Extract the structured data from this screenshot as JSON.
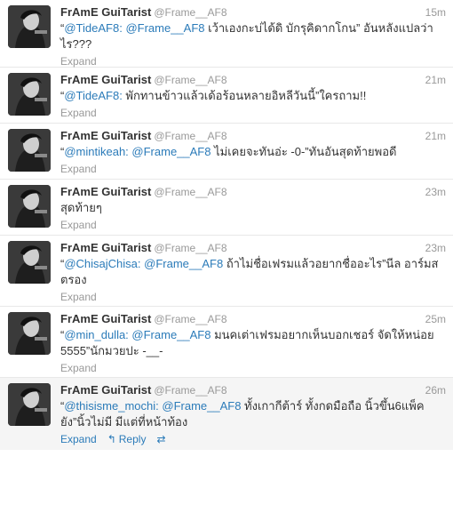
{
  "user": {
    "fullname": "FrAmE GuiTarist",
    "username": "@Frame__AF8"
  },
  "expand_label": "Expand",
  "reply_label": "Reply",
  "tweets": [
    {
      "time": "15m",
      "quote_open": "“",
      "mention1": "@TideAF8:",
      "mention2": "@Frame__AF8",
      "body": " เว้าเองกะบ่ได้ดิ บักรุคิดากโกน” อันหลังแปลว่าไร???"
    },
    {
      "time": "21m",
      "quote_open": "“",
      "mention1": "@TideAF8:",
      "mention2": "",
      "body": " พักทานข้าวแล้วเด้อร้อนหลายอิหลีวันนี้”ใครถาม!!"
    },
    {
      "time": "21m",
      "quote_open": "“",
      "mention1": "@mintikeah:",
      "mention2": "@Frame__AF8",
      "body": " ไม่เคยจะทันอ่ะ -0-”ทันอันสุดท้ายพอดี"
    },
    {
      "time": "23m",
      "quote_open": "",
      "mention1": "",
      "mention2": "",
      "body": "สุดท้ายๆ"
    },
    {
      "time": "23m",
      "quote_open": "“",
      "mention1": "@ChisajChisa:",
      "mention2": "@Frame__AF8",
      "body": " ถ้าไม่ชื่อเฟรมแล้วอยากชื่ออะไร”นีล อาร์มสตรอง"
    },
    {
      "time": "25m",
      "quote_open": "“",
      "mention1": "@min_dulla:",
      "mention2": "@Frame__AF8",
      "body": " มนคเต่าเฟรมอยากเห็นบอกเชอร์ จัดให้หน่อย 5555”นักมวยปะ -__-"
    },
    {
      "time": "26m",
      "quote_open": "“",
      "mention1": "@thisisme_mochi:",
      "mention2": "@Frame__AF8",
      "body": " ทั้งเกากีต้าร์ ทั้งกดมือถือ นิ้วขึ้น6แพ็คยัง”นิ้วไม่มี มีแต่ที่หน้าท้อง"
    }
  ]
}
